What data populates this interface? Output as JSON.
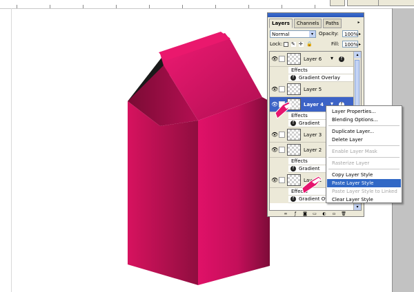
{
  "top_fragment": {
    "left_text": "",
    "mid_text": "",
    "right_text": ""
  },
  "palette": {
    "tabs": [
      "Layers",
      "Channels",
      "Paths"
    ],
    "blend_mode": "Normal",
    "opacity_label": "Opacity:",
    "opacity_value": "100%",
    "lock_label": "Lock:",
    "fill_label": "Fill:",
    "fill_value": "100%"
  },
  "layers": [
    {
      "name": "Layer 6",
      "has_fx": true,
      "selected": false
    },
    {
      "name": "Layer 5",
      "has_fx": false,
      "selected": false
    },
    {
      "name": "Layer 4",
      "has_fx": true,
      "selected": true
    },
    {
      "name": "Layer 3",
      "has_fx": false,
      "selected": false
    },
    {
      "name": "Layer 2",
      "has_fx": false,
      "selected": false
    },
    {
      "name": "Layer 1",
      "has_fx": true,
      "selected": false
    }
  ],
  "effects_label": "Effects",
  "gradient_overlay_label": "Gradient Overlay",
  "gradient_truncated_label": "Gradient",
  "context_menu": {
    "items": [
      {
        "label": "Layer Properties...",
        "disabled": false,
        "highlighted": false
      },
      {
        "label": "Blending Options...",
        "disabled": false,
        "highlighted": false
      },
      {
        "label": "Duplicate Layer...",
        "disabled": false,
        "highlighted": false
      },
      {
        "label": "Delete Layer",
        "disabled": false,
        "highlighted": false
      },
      {
        "label": "Enable Layer Mask",
        "disabled": true,
        "highlighted": false
      },
      {
        "label": "Rasterize Layer",
        "disabled": true,
        "highlighted": false
      },
      {
        "label": "Copy Layer Style",
        "disabled": false,
        "highlighted": false
      },
      {
        "label": "Paste Layer Style",
        "disabled": false,
        "highlighted": true
      },
      {
        "label": "Paste Layer Style to Linked",
        "disabled": true,
        "highlighted": false
      },
      {
        "label": "Clear Layer Style",
        "disabled": false,
        "highlighted": false
      }
    ]
  },
  "colors": {
    "carton_pink": "#d5105f",
    "selection_blue": "#3168c6",
    "palette_bg": "#ece9d8"
  }
}
